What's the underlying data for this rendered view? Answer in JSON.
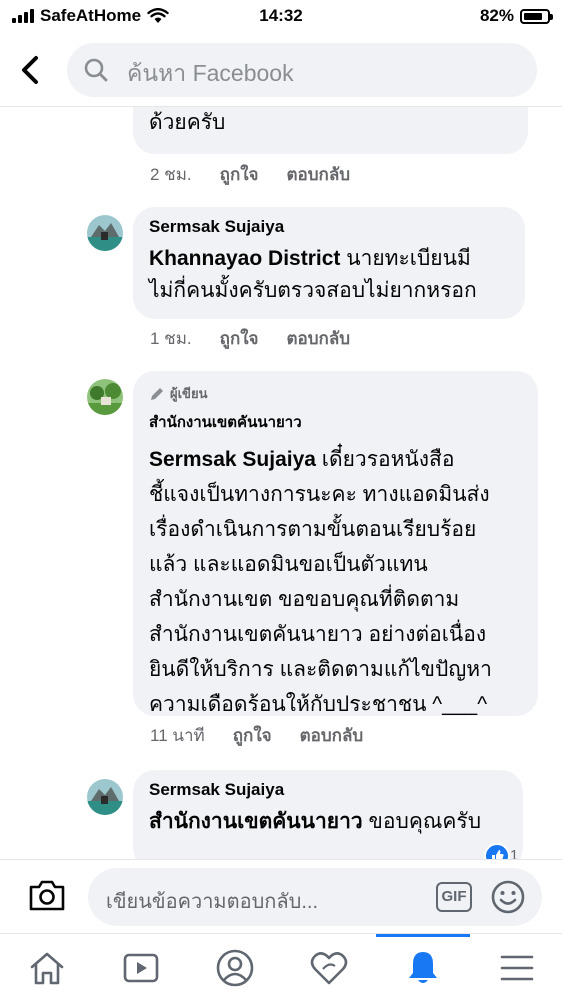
{
  "status_bar": {
    "carrier": "SafeAtHome",
    "time": "14:32",
    "battery": "82%",
    "battery_level": 0.82
  },
  "search": {
    "placeholder": "ค้นหา Facebook"
  },
  "comments": [
    {
      "text": "ด้วยครับ",
      "time": "2 ชม.",
      "like": "ถูกใจ",
      "reply": "ตอบกลับ"
    },
    {
      "author": "Sermsak Sujaiya",
      "mention": "Khannayao District",
      "text_lines": [
        " นายทะเบียนมี",
        "ไม่กี่คนมั้งครับตรวจสอบไม่ยากหรอก"
      ],
      "time": "1 ชม.",
      "like": "ถูกใจ",
      "reply": "ตอบกลับ"
    },
    {
      "badge": "ผู้เขียน",
      "author": "สำนักงานเขตคันนายาว",
      "mention": "Sermsak Sujaiya",
      "text_lines": [
        " เดี๋ยวรอหนังสือ",
        "ชี้แจงเป็นทางการนะคะ ทางแอดมินส่ง",
        "เรื่องดำเนินการตามขั้นตอนเรียบร้อย",
        "แล้ว และแอดมินขอเป็นตัวแทน",
        "สำนักงานเขต ขอขอบคุณที่ติดตาม",
        "สำนักงานเขตคันนายาว อย่างต่อเนื่อง",
        "ยินดีให้บริการ และติดตามแก้ไขปัญหา",
        "ความเดือดร้อนให้กับประชาชน ^___^"
      ],
      "time": "11 นาที",
      "like": "ถูกใจ",
      "reply": "ตอบกลับ"
    },
    {
      "author": "Sermsak Sujaiya",
      "mention": "สำนักงานเขตคันนายาว",
      "text": " ขอบคุณครับ",
      "reaction_count": "1"
    }
  ],
  "composer": {
    "placeholder": "เขียนข้อความตอบกลับ...",
    "gif_label": "GIF"
  },
  "tabs": [
    "home-icon",
    "watch-icon",
    "profile-icon",
    "dating-icon",
    "notifications-icon",
    "menu-icon"
  ],
  "colors": {
    "accent": "#1877f2",
    "bubble": "#f0f2f5",
    "meta_text": "#65676b"
  }
}
